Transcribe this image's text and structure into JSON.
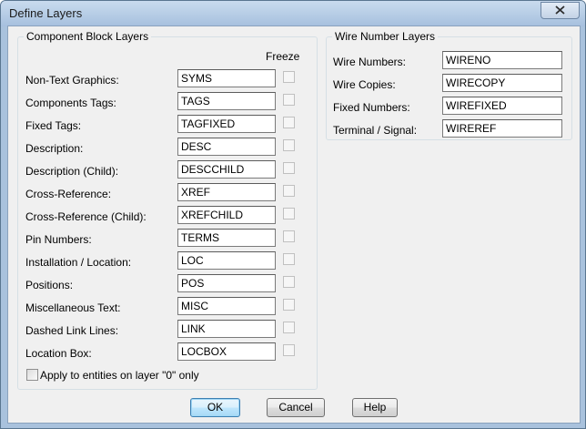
{
  "window": {
    "title": "Define Layers"
  },
  "component_group": {
    "title": "Component Block Layers",
    "freeze_header": "Freeze",
    "rows": [
      {
        "label": "Non-Text Graphics:",
        "value": "SYMS",
        "freeze": false
      },
      {
        "label": "Components Tags:",
        "value": "TAGS",
        "freeze": false
      },
      {
        "label": "Fixed Tags:",
        "value": "TAGFIXED",
        "freeze": false
      },
      {
        "label": "Description:",
        "value": "DESC",
        "freeze": false
      },
      {
        "label": "Description (Child):",
        "value": "DESCCHILD",
        "freeze": false
      },
      {
        "label": "Cross-Reference:",
        "value": "XREF",
        "freeze": false
      },
      {
        "label": "Cross-Reference (Child):",
        "value": "XREFCHILD",
        "freeze": false
      },
      {
        "label": "Pin Numbers:",
        "value": "TERMS",
        "freeze": false
      },
      {
        "label": "Installation / Location:",
        "value": "LOC",
        "freeze": false
      },
      {
        "label": "Positions:",
        "value": "POS",
        "freeze": false
      },
      {
        "label": "Miscellaneous Text:",
        "value": "MISC",
        "freeze": false
      },
      {
        "label": "Dashed Link Lines:",
        "value": "LINK",
        "freeze": false
      },
      {
        "label": "Location Box:",
        "value": "LOCBOX",
        "freeze": false
      }
    ],
    "apply_layer0": {
      "label": "Apply to entities on layer \"0\" only",
      "checked": false
    }
  },
  "wire_group": {
    "title": "Wire Number Layers",
    "rows": [
      {
        "label": "Wire Numbers:",
        "value": "WIRENO"
      },
      {
        "label": "Wire Copies:",
        "value": "WIRECOPY"
      },
      {
        "label": "Fixed Numbers:",
        "value": "WIREFIXED"
      },
      {
        "label": "Terminal / Signal:",
        "value": "WIREREF"
      }
    ]
  },
  "buttons": {
    "ok": "OK",
    "cancel": "Cancel",
    "help": "Help"
  }
}
